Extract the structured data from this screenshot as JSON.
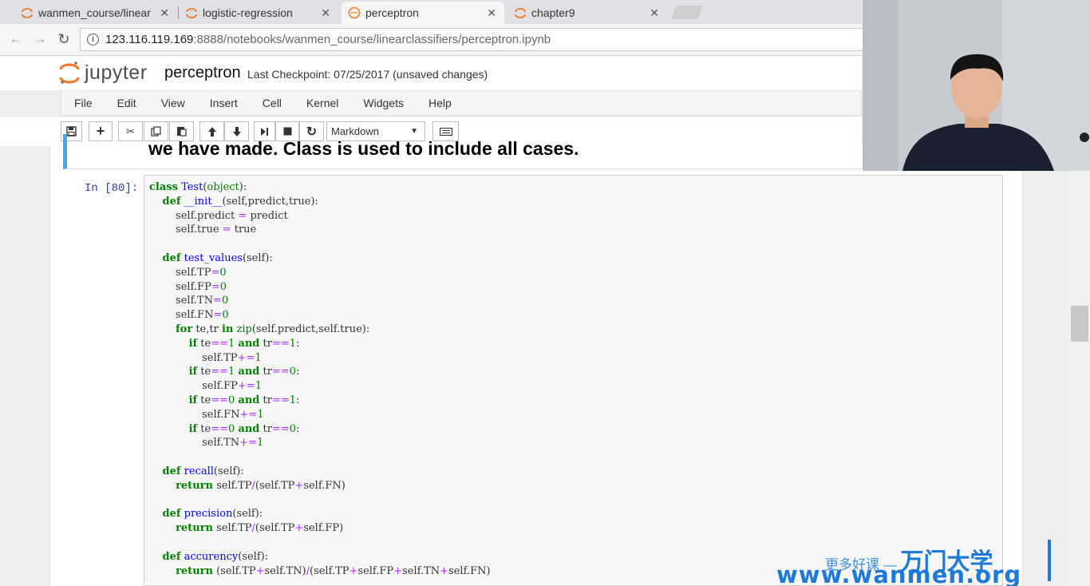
{
  "browser": {
    "tabs": [
      {
        "title": "wanmen_course/linear",
        "icon": "jupyter-favicon"
      },
      {
        "title": "logistic-regression",
        "icon": "jupyter-favicon"
      },
      {
        "title": "perceptron",
        "icon": "jupyter-busy-favicon",
        "active": true
      },
      {
        "title": "chapter9",
        "icon": "jupyter-favicon"
      }
    ],
    "close_glyph": "✕",
    "url_host": "123.116.119.169",
    "url_rest": ":8888/notebooks/wanmen_course/linearclassifiers/perceptron.ipynb"
  },
  "jupyter": {
    "logo_text": "jupyter",
    "notebook_name": "perceptron",
    "checkpoint": "Last Checkpoint: 07/25/2017 (unsaved changes)",
    "menu": [
      "File",
      "Edit",
      "View",
      "Insert",
      "Cell",
      "Kernel",
      "Widgets",
      "Help"
    ],
    "cell_type": "Markdown"
  },
  "markdown_cell": {
    "text": "we have made. Class is used to include all cases."
  },
  "code_cell": {
    "prompt": "In  [80]:"
  },
  "watermark": {
    "line1": "更多好课 —",
    "brand": "万门大学",
    "url": "www.wanmen.org"
  },
  "colors": {
    "accent_blue": "#42a5f5",
    "prompt_blue": "#303f9f",
    "keyword_green": "#008000",
    "function_blue": "#0000ff",
    "operator_purple": "#aa22ff",
    "watermark_blue": "#1e7ad8"
  }
}
